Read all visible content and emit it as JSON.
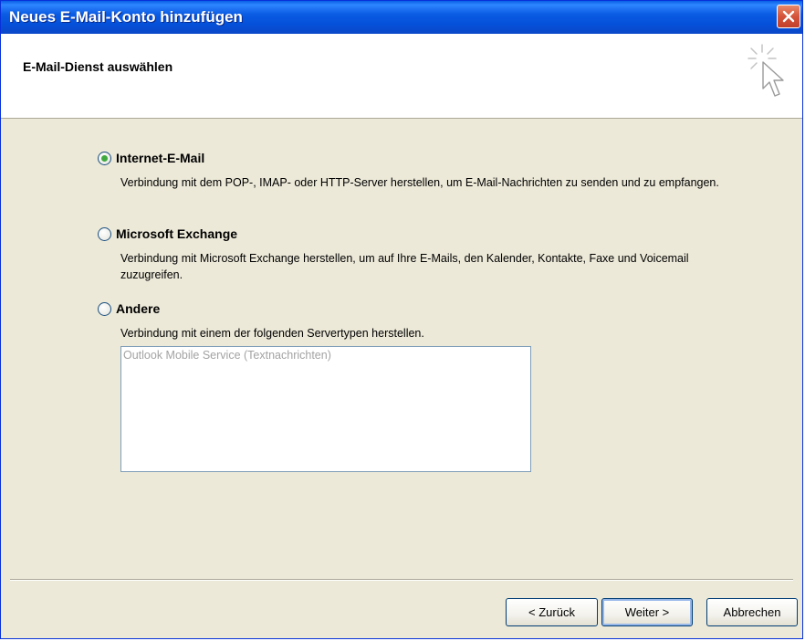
{
  "window": {
    "title": "Neues E-Mail-Konto hinzufügen"
  },
  "header": {
    "title": "E-Mail-Dienst auswählen",
    "icon": "wizard-cursor-icon"
  },
  "options": [
    {
      "label": "Internet-E-Mail",
      "description": "Verbindung mit dem POP-, IMAP- oder HTTP-Server herstellen, um E-Mail-Nachrichten zu senden und zu empfangen.",
      "selected": true
    },
    {
      "label": "Microsoft Exchange",
      "description": "Verbindung mit Microsoft Exchange herstellen, um auf Ihre E-Mails, den Kalender, Kontakte, Faxe und Voicemail zuzugreifen.",
      "selected": false
    },
    {
      "label": "Andere",
      "description": "Verbindung mit einem der folgenden Servertypen herstellen.",
      "selected": false
    }
  ],
  "server_types": [
    "Outlook Mobile Service (Textnachrichten)"
  ],
  "buttons": {
    "back": "< Zurück",
    "next": "Weiter >",
    "cancel": "Abbrechen"
  },
  "colors": {
    "titlebar": "#0a5fe6",
    "dialog_bg": "#ece9d8",
    "close_button": "#d4533a",
    "radio_selected": "#3fa93f"
  }
}
